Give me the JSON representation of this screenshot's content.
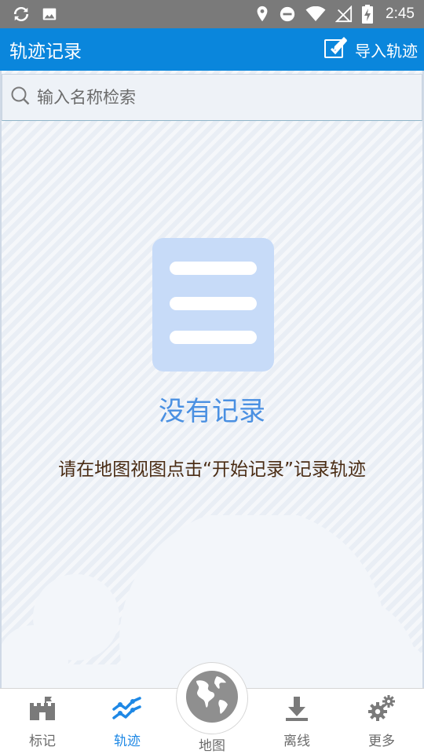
{
  "status_bar": {
    "time": "2:45",
    "icons": [
      "sync-icon",
      "image-icon",
      "location-icon",
      "do-not-disturb-icon",
      "wifi-icon",
      "signal-off-icon",
      "battery-charging-icon"
    ]
  },
  "app_bar": {
    "title": "轨迹记录",
    "import_label": "导入轨迹",
    "import_icon": "edit-import-icon"
  },
  "search": {
    "placeholder": "输入名称检索",
    "value": ""
  },
  "empty_state": {
    "title": "没有记录",
    "hint": "请在地图视图点击“开始记录”记录轨迹"
  },
  "bottom_nav": {
    "items": [
      {
        "label": "标记",
        "icon": "castle-icon",
        "active": false
      },
      {
        "label": "轨迹",
        "icon": "track-icon",
        "active": true
      },
      {
        "label": "地图",
        "icon": "globe-icon",
        "active": false
      },
      {
        "label": "离线",
        "icon": "download-icon",
        "active": false
      },
      {
        "label": "更多",
        "icon": "gears-icon",
        "active": false
      }
    ]
  },
  "colors": {
    "app_bar": "#0a86dc",
    "accent": "#1e88e5",
    "empty_title": "#4a90e2",
    "hint_text": "#4a2c14"
  }
}
